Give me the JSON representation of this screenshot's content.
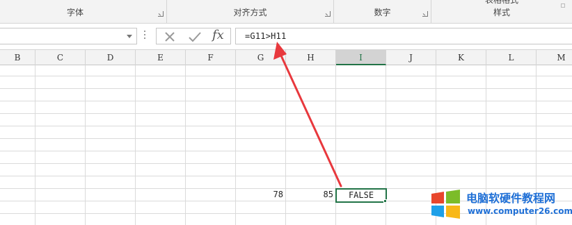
{
  "ribbon": {
    "groups": [
      {
        "label": "字体"
      },
      {
        "label": "对齐方式"
      },
      {
        "label": "数字"
      },
      {
        "label": "表格格式"
      },
      {
        "label": "样式"
      }
    ]
  },
  "formula_bar": {
    "name_box_value": "",
    "cancel_icon": "cross-icon",
    "enter_icon": "check-icon",
    "function_glyph": "fx",
    "formula": "=G11>H11"
  },
  "columns": [
    "B",
    "C",
    "D",
    "E",
    "F",
    "G",
    "H",
    "I",
    "J",
    "K",
    "L",
    "M"
  ],
  "active_column": "I",
  "cells": {
    "G11": "78",
    "H11": "85",
    "I11": "FALSE"
  },
  "watermark": {
    "title": "电脑软硬件教程网",
    "url": "www.computer26.com"
  },
  "colors": {
    "accent": "#217346",
    "arrow": "#e8383d",
    "watermark_text": "#1e6fd6"
  }
}
